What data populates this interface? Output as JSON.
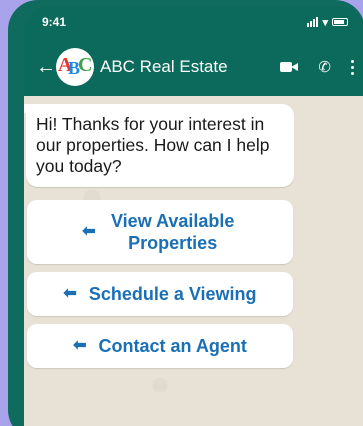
{
  "status_bar": {
    "time": "9:41"
  },
  "header": {
    "contact_name": "ABC Real Estate",
    "avatar_letters": [
      "A",
      "B",
      "C"
    ],
    "icons": [
      "back-arrow-icon",
      "video-call-icon",
      "phone-call-icon",
      "more-menu-icon"
    ]
  },
  "chat": {
    "message": "Hi! Thanks for your interest in our properties. How can I help you today?",
    "quick_replies": [
      {
        "label": "View Available Properties"
      },
      {
        "label": "Schedule a Viewing"
      },
      {
        "label": "Contact an Agent"
      }
    ]
  },
  "colors": {
    "page_background": "#a9a3ec",
    "header_green": "#0b6a5b",
    "chat_background": "#e8e2d6",
    "reply_text_blue": "#1b6fb5"
  }
}
